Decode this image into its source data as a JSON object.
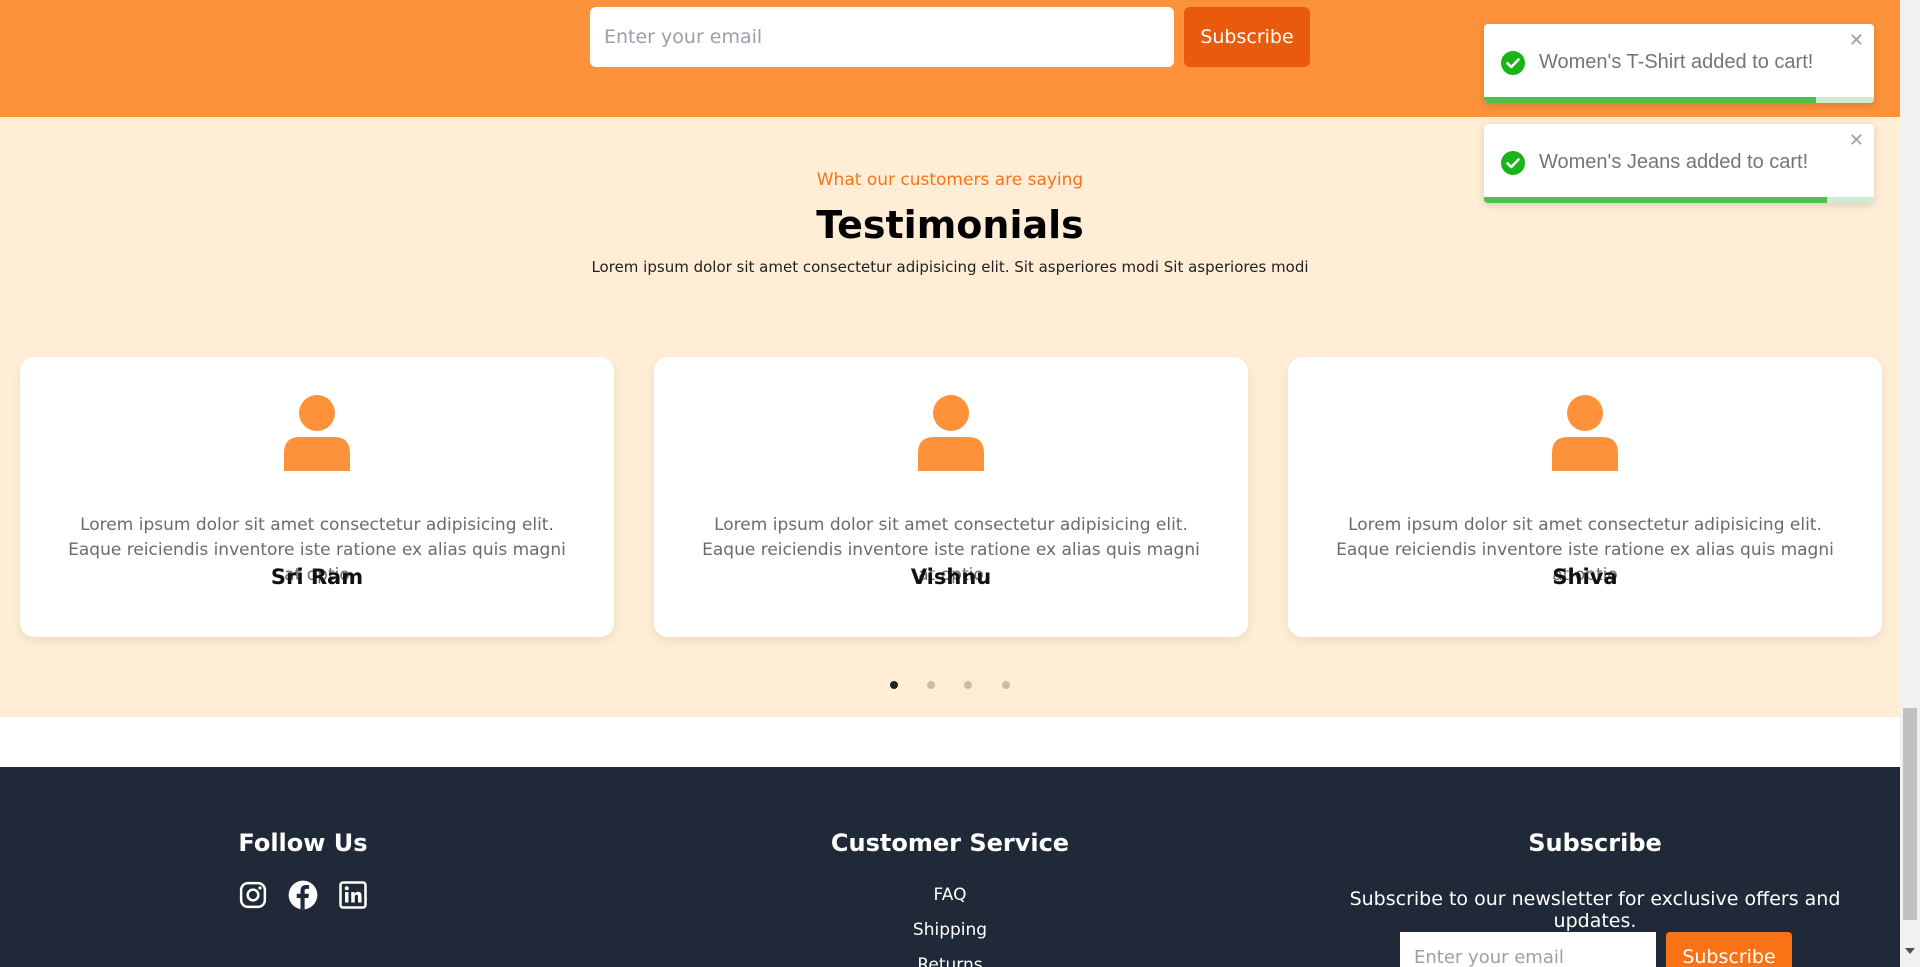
{
  "top_newsletter": {
    "email_placeholder": "Enter your email",
    "subscribe_label": "Subscribe"
  },
  "testimonials": {
    "kicker": "What our customers are saying",
    "title": "Testimonials",
    "lead": "Lorem ipsum dolor sit amet consectetur adipisicing elit. Sit asperiores modi Sit asperiores modi",
    "items": [
      {
        "quote": "Lorem ipsum dolor sit amet consectetur adipisicing elit. Eaque reiciendis inventore iste ratione ex alias quis magni at optio",
        "name": "Sri Ram",
        "icon": "user-icon"
      },
      {
        "quote": "Lorem ipsum dolor sit amet consectetur adipisicing elit. Eaque reiciendis inventore iste ratione ex alias quis magni at optio",
        "name": "Vishnu",
        "icon": "user-icon"
      },
      {
        "quote": "Lorem ipsum dolor sit amet consectetur adipisicing elit. Eaque reiciendis inventore iste ratione ex alias quis magni at optio",
        "name": "Shiva",
        "icon": "user-icon"
      }
    ],
    "pagination": {
      "count": 4,
      "active_index": 0
    }
  },
  "footer": {
    "follow": {
      "title": "Follow Us",
      "icons": [
        "instagram-icon",
        "facebook-icon",
        "linkedin-icon"
      ]
    },
    "customer_service": {
      "title": "Customer Service",
      "links": [
        "FAQ",
        "Shipping",
        "Returns"
      ]
    },
    "subscribe": {
      "title": "Subscribe",
      "text": "Subscribe to our newsletter for exclusive offers and updates.",
      "email_placeholder": "Enter your email",
      "button_label": "Subscribe"
    }
  },
  "toasts": [
    {
      "message": "Women's T-Shirt added to cart!",
      "progress": 0.85,
      "icon": "check-circle-icon",
      "close_label": "✕"
    },
    {
      "message": "Women's Jeans added to cart!",
      "progress": 0.88,
      "icon": "check-circle-icon",
      "close_label": "✕"
    }
  ],
  "colors": {
    "accent": "#fd923b",
    "accent_dark": "#ea5a0c",
    "testimonial_bg": "#ffedd5",
    "footer_bg": "#1f2937",
    "success": "#4bc24b"
  }
}
